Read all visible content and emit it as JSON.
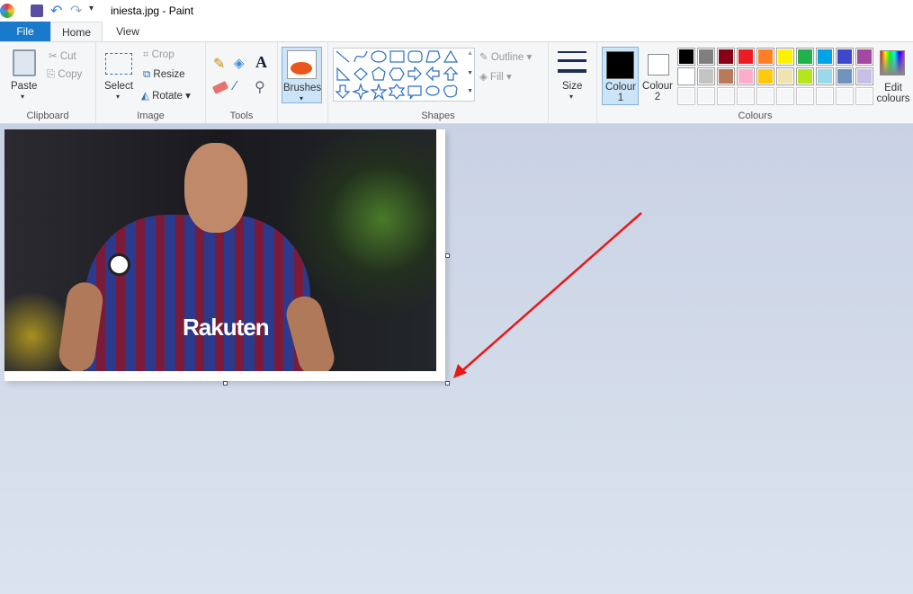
{
  "window": {
    "title": "iniesta.jpg - Paint"
  },
  "tabs": [
    {
      "label": "File"
    },
    {
      "label": "Home"
    },
    {
      "label": "View"
    }
  ],
  "clipboard": {
    "paste": "Paste",
    "cut": "Cut",
    "copy": "Copy",
    "label": "Clipboard"
  },
  "image": {
    "select": "Select",
    "crop": "Crop",
    "resize": "Resize",
    "rotate": "Rotate",
    "label": "Image"
  },
  "tools": {
    "label": "Tools",
    "icons": [
      "pencil-icon",
      "fill-icon",
      "text-icon",
      "eraser-icon",
      "color-picker-icon",
      "magnifier-icon"
    ]
  },
  "brushes": {
    "label": "Brushes"
  },
  "shapes": {
    "label": "Shapes",
    "outline": "Outline",
    "fill": "Fill"
  },
  "size": {
    "label": "Size"
  },
  "colours": {
    "colour1_a": "Colour",
    "colour1_b": "1",
    "colour2_a": "Colour",
    "colour2_b": "2",
    "edit_a": "Edit",
    "edit_b": "colours",
    "label": "Colours",
    "colour1": "#000000",
    "colour2": "#ffffff",
    "palette_row1": [
      "#000000",
      "#7f7f7f",
      "#880015",
      "#ed1c24",
      "#ff7f27",
      "#fff200",
      "#22b14c",
      "#00a2e8",
      "#3f48cc",
      "#a349a4"
    ],
    "palette_row2": [
      "#ffffff",
      "#c3c3c3",
      "#b97a57",
      "#ffaec9",
      "#ffc90e",
      "#efe4b0",
      "#b5e61d",
      "#99d9ea",
      "#7092be",
      "#c8bfe7"
    ]
  },
  "annotation": {
    "arrow_color": "#e81818"
  }
}
